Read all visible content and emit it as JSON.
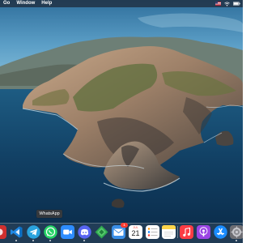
{
  "menubar": {
    "items": [
      "Go",
      "Window",
      "Help"
    ]
  },
  "tooltip": {
    "text": "WhatsApp"
  },
  "dock": {
    "items": [
      {
        "name": "app-partial",
        "icon": "app-icon",
        "color": "#d0302e"
      },
      {
        "name": "vscode",
        "icon": "vscode-icon",
        "color": "#1e88e5"
      },
      {
        "name": "telegram",
        "icon": "telegram-icon",
        "color": "#2aa3de"
      },
      {
        "name": "whatsapp",
        "icon": "whatsapp-icon",
        "color": "#25d366"
      },
      {
        "name": "zoom",
        "icon": "zoom-icon",
        "color": "#2d8cff"
      },
      {
        "name": "discord",
        "icon": "discord-icon",
        "color": "#5865f2"
      },
      {
        "name": "sketch",
        "icon": "diamond-icon",
        "color": "#2fa84f"
      },
      {
        "name": "mail",
        "icon": "mail-icon",
        "color": "#3a8ee6",
        "badge": "1"
      },
      {
        "name": "calendar",
        "icon": "calendar-icon",
        "color": "#ffffff",
        "month": "JUL",
        "day": "21"
      },
      {
        "name": "reminders",
        "icon": "list-icon",
        "color": "#ffffff"
      },
      {
        "name": "notes",
        "icon": "notes-icon",
        "color": "#ffd54a"
      },
      {
        "name": "music",
        "icon": "music-icon",
        "color": "#fc3c44"
      },
      {
        "name": "podcasts",
        "icon": "podcasts-icon",
        "color": "#9b45e4"
      },
      {
        "name": "app-store",
        "icon": "app-store-icon",
        "color": "#1a8cff"
      },
      {
        "name": "system-preferences",
        "icon": "gear-icon",
        "color": "#8e8e93"
      }
    ]
  }
}
